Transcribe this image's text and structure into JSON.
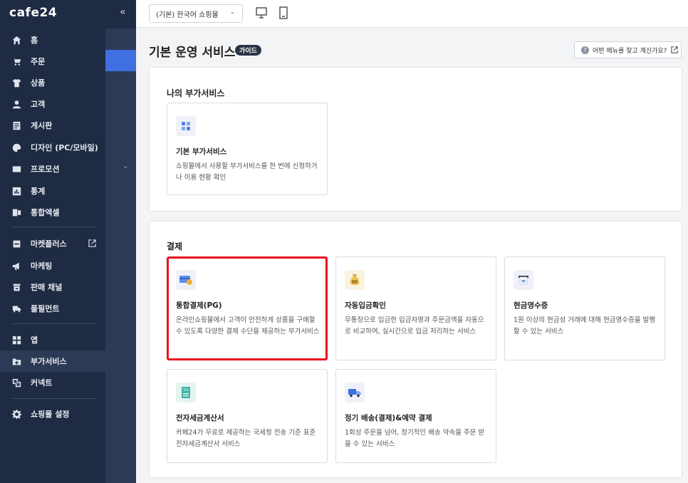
{
  "app": {
    "logo": "cafe24"
  },
  "sidebar": {
    "collapse": "«",
    "items": [
      {
        "label": "홈",
        "icon": "home-icon"
      },
      {
        "label": "주문",
        "icon": "cart-icon"
      },
      {
        "label": "상품",
        "icon": "shirt-icon"
      },
      {
        "label": "고객",
        "icon": "user-icon"
      },
      {
        "label": "게시판",
        "icon": "board-icon"
      },
      {
        "label": "디자인 (PC/모바일)",
        "icon": "palette-icon"
      },
      {
        "label": "프로모션",
        "icon": "ticket-icon"
      },
      {
        "label": "통계",
        "icon": "chart-icon"
      },
      {
        "label": "통합엑셀",
        "icon": "excel-icon"
      },
      {
        "label": "마켓플러스",
        "icon": "market-icon"
      },
      {
        "label": "마케팅",
        "icon": "megaphone-icon"
      },
      {
        "label": "판매 채널",
        "icon": "channel-icon"
      },
      {
        "label": "풀필먼트",
        "icon": "truck-icon"
      },
      {
        "label": "앱",
        "icon": "apps-icon"
      },
      {
        "label": "부가서비스",
        "icon": "folder-plus-icon"
      },
      {
        "label": "커넥트",
        "icon": "connect-icon"
      },
      {
        "label": "쇼핑몰 설정",
        "icon": "gear-icon"
      }
    ]
  },
  "topbar": {
    "shop_select": "(기본) 한국어 쇼핑몰",
    "chevron": "⌄"
  },
  "main": {
    "title": "기본 운영 서비스",
    "guide": "가이드",
    "help": "어떤 메뉴를 찾고 계신가요?",
    "help_q": "?"
  },
  "my_services": {
    "title": "나의 부가서비스",
    "cards": [
      {
        "title": "기본 부가서비스",
        "desc": "쇼핑몰에서 사용할 부가서비스를 한 번에 신청하거나 이용 현황 확인"
      }
    ]
  },
  "payment": {
    "title": "결제",
    "cards": [
      {
        "title": "통합결제(PG)",
        "desc": "온라인쇼핑몰에서 고객이 안전하게 상품을 구매할 수 있도록 다양한 결제 수단을 제공하는 부가서비스"
      },
      {
        "title": "자동입금확인",
        "desc": "무통장으로 입금한 입금자명과 주문금액을 자동으로 비교하여, 실시간으로 입금 처리하는 서비스"
      },
      {
        "title": "현금영수증",
        "desc": "1원 이상의 현금성 거래에 대해 현금영수증을 발행할 수 있는 서비스"
      },
      {
        "title": "전자세금계산서",
        "desc": "카페24가 무료로 제공하는 국세청 전송 기준 표준전자세금계산서 서비스"
      },
      {
        "title": "정기 배송(결제)&예약 결제",
        "desc": "1회성 주문을 넘어, 정기적인 배송 약속을 주문 받을 수 있는 서비스"
      }
    ]
  },
  "colors": {
    "sidebar": "#1f2b43",
    "accent": "#3f6fe0",
    "highlight": "#e8141b"
  }
}
